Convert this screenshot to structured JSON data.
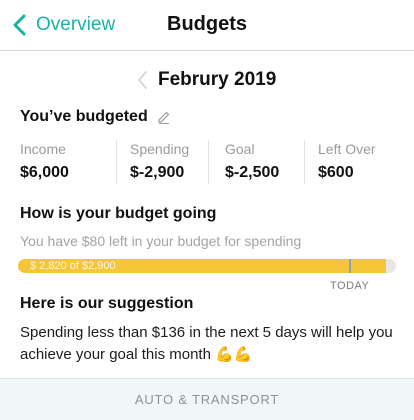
{
  "nav": {
    "back_label": "Overview",
    "title": "Budgets"
  },
  "month": {
    "label": "Februry 2019"
  },
  "budgeted": {
    "heading": "You’ve budgeted",
    "stats": [
      {
        "label": "Income",
        "value": "$6,000"
      },
      {
        "label": "Spending",
        "value": "$-2,900"
      },
      {
        "label": "Goal",
        "value": "$-2,500"
      },
      {
        "label": "Left Over",
        "value": "$600"
      }
    ]
  },
  "going": {
    "heading": "How is your budget going",
    "subtext": "You have $80 left in your budget for spending",
    "progress_label": "$ 2,820 of $2,900",
    "progress_fraction": 0.9724,
    "today_label": "TODAY"
  },
  "suggestion": {
    "heading": "Here is our suggestion",
    "text": "Spending less than $136 in the next 5 days will help you achieve your goal this month",
    "emoji": "💪💪"
  },
  "category": {
    "label": "AUTO & TRANSPORT"
  },
  "colors": {
    "accent": "#17b3a6",
    "progress": "#f5c53a",
    "track": "#e6e6e6"
  },
  "icons": {
    "back": "chevron-left-icon",
    "month_prev": "chevron-left-icon",
    "edit": "pencil-icon"
  }
}
